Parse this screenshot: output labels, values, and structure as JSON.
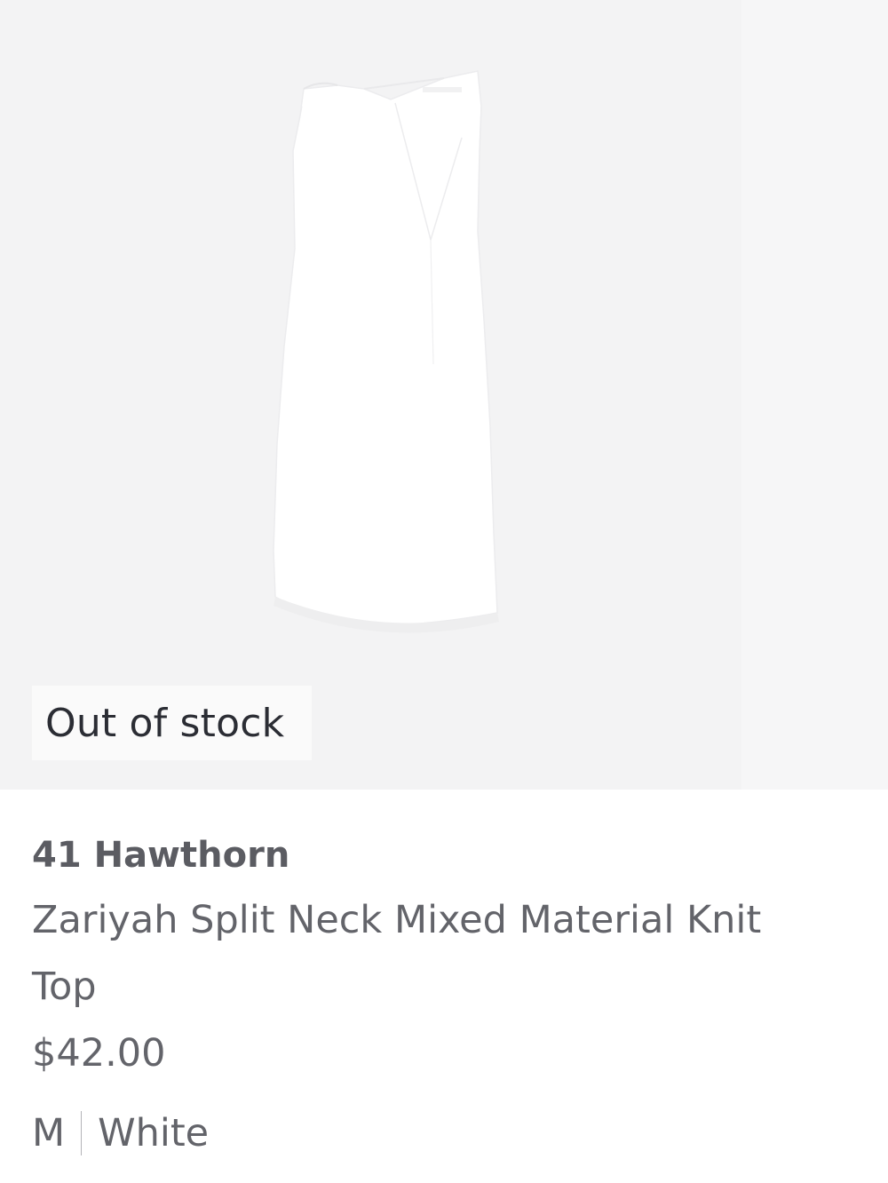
{
  "product": {
    "image": {
      "icon": "sleeveless-top-image",
      "background_color": "#f4f4f5"
    },
    "stock_badge": "Out of stock",
    "brand": "41 Hawthorn",
    "name": "Zariyah Split Neck Mixed Material Knit Top",
    "price": "$42.00",
    "size": "M",
    "color": "White"
  }
}
